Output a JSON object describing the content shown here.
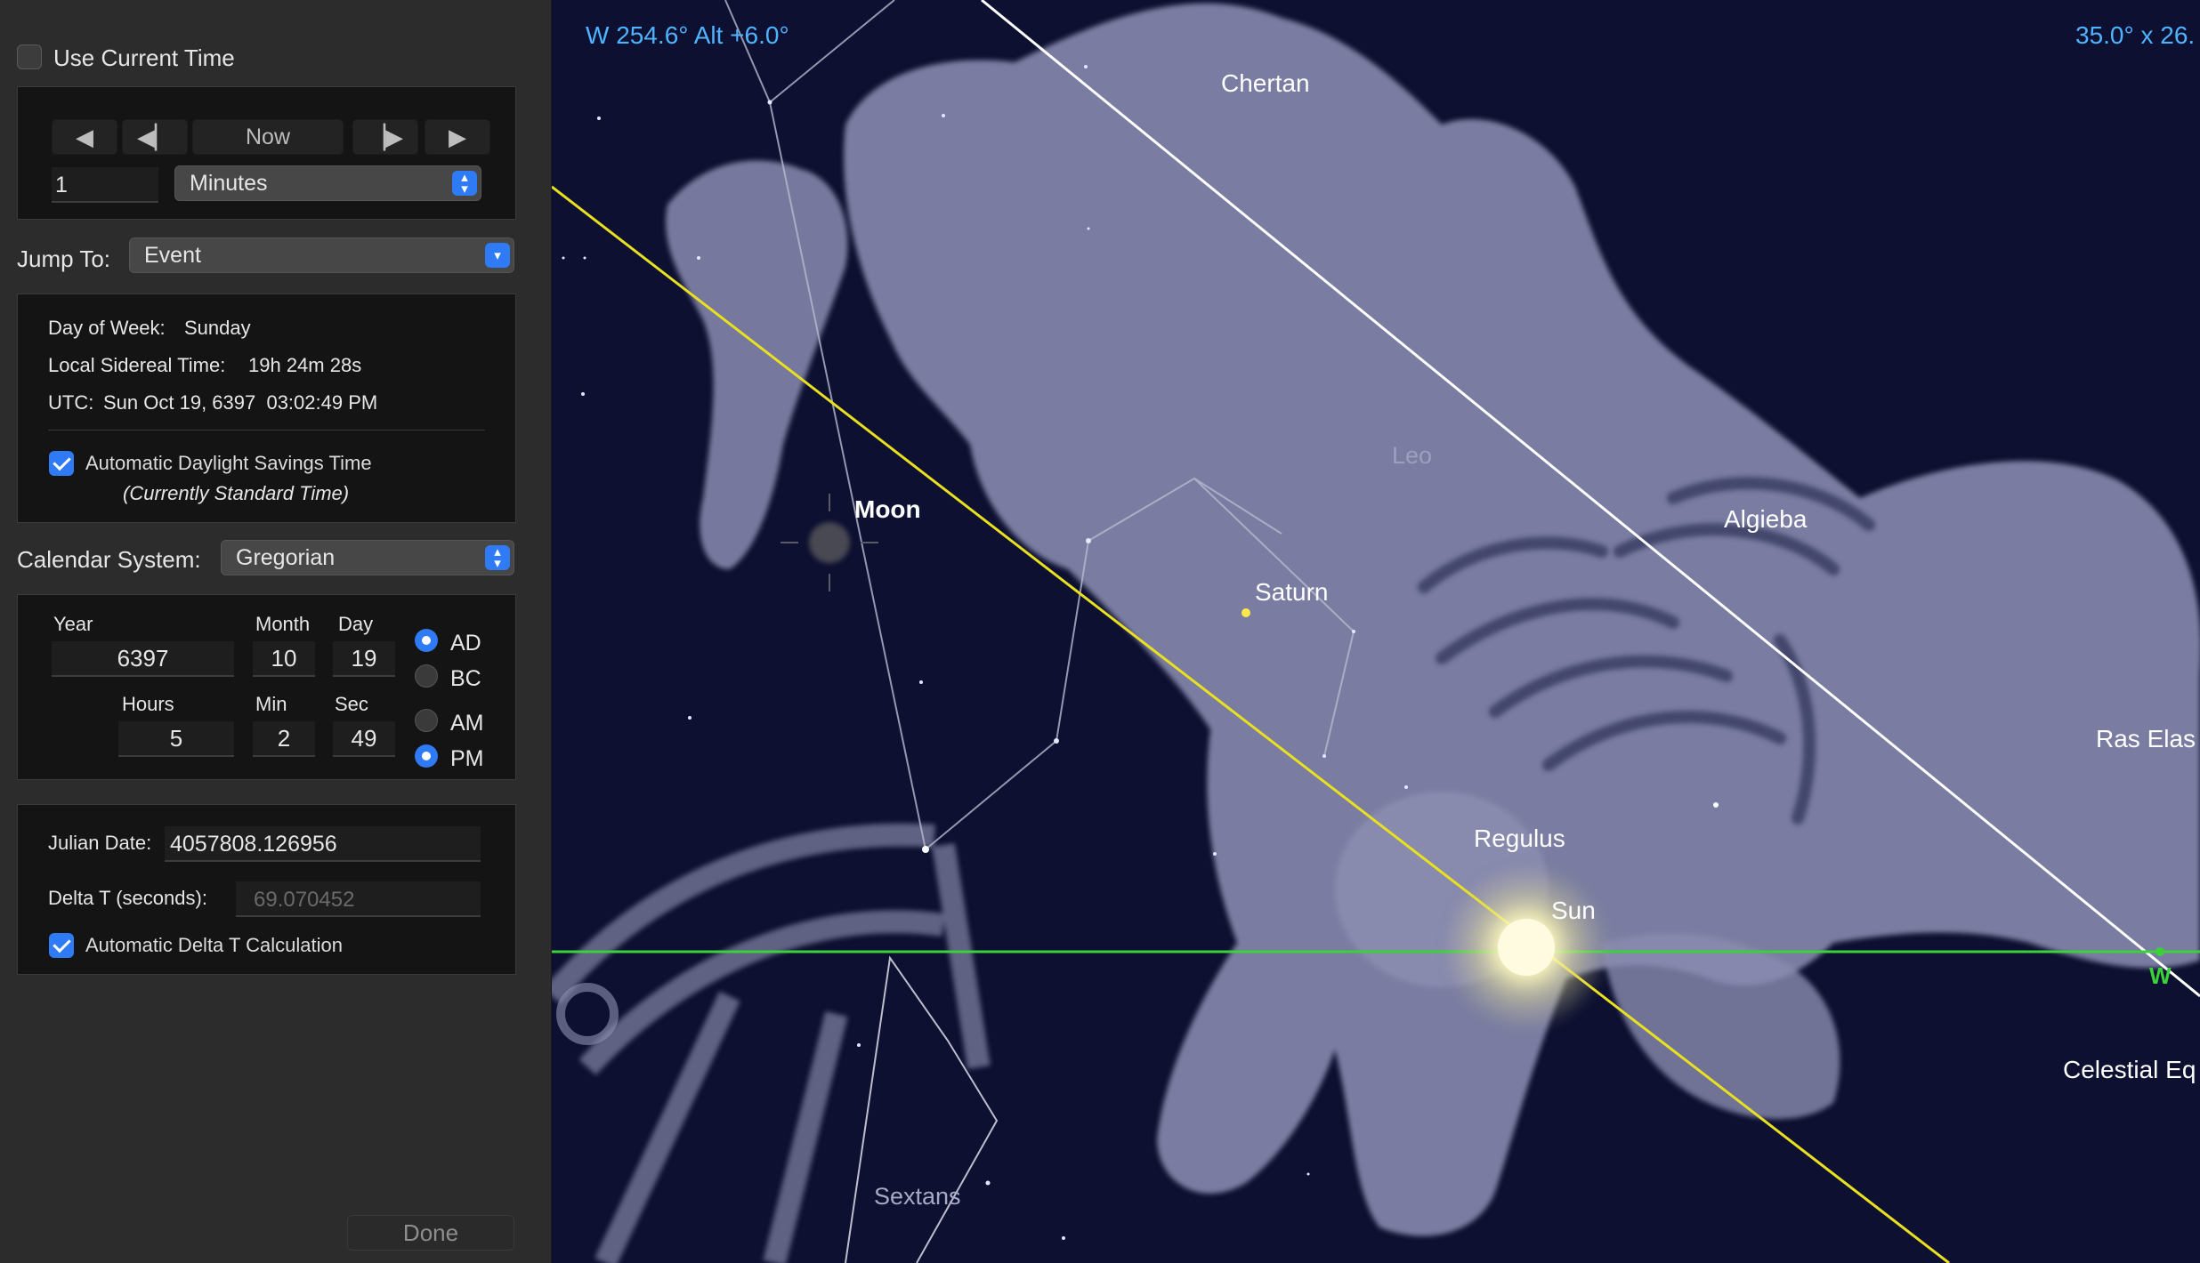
{
  "panel": {
    "use_current_time": {
      "label": "Use Current Time",
      "checked": false
    },
    "time_controls": {
      "step_back_fast_icon": "triangle-left-icon",
      "step_back_icon": "step-back-icon",
      "now_label": "Now",
      "step_forward_icon": "step-forward-icon",
      "step_forward_fast_icon": "triangle-right-icon",
      "step_value": "1",
      "step_unit": "Minutes"
    },
    "jump_to": {
      "label": "Jump To:",
      "value": "Event"
    },
    "info": {
      "day_of_week_label": "Day of Week:",
      "day_of_week": "Sunday",
      "lst_label": "Local Sidereal Time:",
      "lst": "19h 24m 28s",
      "utc_label": "UTC:",
      "utc": "Sun Oct 19, 6397  03:02:49 PM",
      "dst_label": "Automatic Daylight Savings Time",
      "dst_checked": true,
      "dst_note": "(Currently Standard Time)"
    },
    "calendar": {
      "label": "Calendar System:",
      "value": "Gregorian"
    },
    "date": {
      "year_label": "Year",
      "year": "6397",
      "month_label": "Month",
      "month": "10",
      "day_label": "Day",
      "day": "19",
      "hours_label": "Hours",
      "hours": "5",
      "min_label": "Min",
      "min": "2",
      "sec_label": "Sec",
      "sec": "49",
      "era_ad": "AD",
      "era_bc": "BC",
      "era_selected": "AD",
      "am": "AM",
      "pm": "PM",
      "ampm_selected": "PM"
    },
    "julian": {
      "jd_label": "Julian Date:",
      "jd": "4057808.126956",
      "delta_t_label": "Delta T (seconds):",
      "delta_t": "69.070452",
      "auto_delta_label": "Automatic Delta T Calculation",
      "auto_delta_checked": true
    },
    "done_label": "Done"
  },
  "sky": {
    "position_readout": "W 254.6° Alt +6.0°",
    "fov_readout": "35.0° x 26.",
    "labels": {
      "chertan": "Chertan",
      "leo": "Leo",
      "moon": "Moon",
      "saturn": "Saturn",
      "algieba": "Algieba",
      "ras_elas": "Ras Elas",
      "regulus": "Regulus",
      "sun": "Sun",
      "west": "W",
      "celestial_equator": "Celestial Eq",
      "sextans": "Sextans"
    },
    "colors": {
      "readout": "#4fb3ff",
      "ecliptic": "#e8e020",
      "horizon": "#3ad13a",
      "equator": "#ffffff",
      "background": "#0d1030"
    }
  }
}
